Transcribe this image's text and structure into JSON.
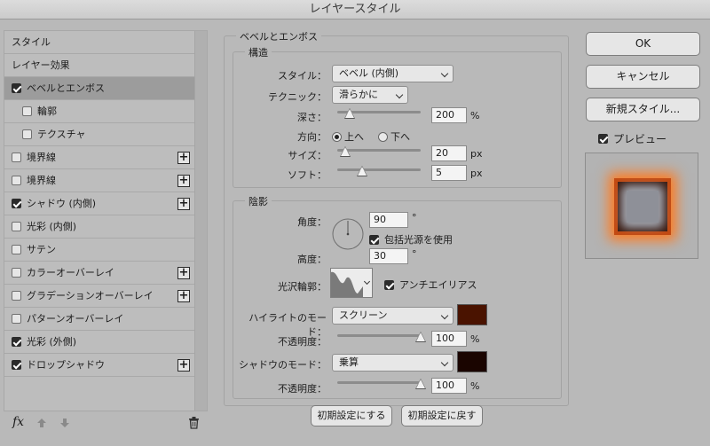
{
  "window": {
    "title": "レイヤースタイル"
  },
  "left_panel": {
    "items": [
      {
        "label": "スタイル",
        "checkbox": false,
        "checked": false,
        "plus": false,
        "selected": false,
        "sub": false
      },
      {
        "label": "レイヤー効果",
        "checkbox": false,
        "checked": false,
        "plus": false,
        "selected": false,
        "sub": false
      },
      {
        "label": "ベベルとエンボス",
        "checkbox": true,
        "checked": true,
        "plus": false,
        "selected": true,
        "sub": false
      },
      {
        "label": "輪郭",
        "checkbox": true,
        "checked": false,
        "plus": false,
        "selected": false,
        "sub": true
      },
      {
        "label": "テクスチャ",
        "checkbox": true,
        "checked": false,
        "plus": false,
        "selected": false,
        "sub": true
      },
      {
        "label": "境界線",
        "checkbox": true,
        "checked": false,
        "plus": true,
        "selected": false,
        "sub": false
      },
      {
        "label": "境界線",
        "checkbox": true,
        "checked": false,
        "plus": true,
        "selected": false,
        "sub": false
      },
      {
        "label": "シャドウ (内側)",
        "checkbox": true,
        "checked": true,
        "plus": true,
        "selected": false,
        "sub": false
      },
      {
        "label": "光彩 (内側)",
        "checkbox": true,
        "checked": false,
        "plus": false,
        "selected": false,
        "sub": false
      },
      {
        "label": "サテン",
        "checkbox": true,
        "checked": false,
        "plus": false,
        "selected": false,
        "sub": false
      },
      {
        "label": "カラーオーバーレイ",
        "checkbox": true,
        "checked": false,
        "plus": true,
        "selected": false,
        "sub": false
      },
      {
        "label": "グラデーションオーバーレイ",
        "checkbox": true,
        "checked": false,
        "plus": true,
        "selected": false,
        "sub": false
      },
      {
        "label": "パターンオーバーレイ",
        "checkbox": true,
        "checked": false,
        "plus": false,
        "selected": false,
        "sub": false
      },
      {
        "label": "光彩 (外側)",
        "checkbox": true,
        "checked": true,
        "plus": false,
        "selected": false,
        "sub": false
      },
      {
        "label": "ドロップシャドウ",
        "checkbox": true,
        "checked": true,
        "plus": true,
        "selected": false,
        "sub": false
      }
    ],
    "plus_symbol": "+",
    "bottom_icons": {
      "fx": "fx",
      "up": "arrow-up-icon",
      "down": "arrow-down-icon",
      "trash": "trash-icon"
    }
  },
  "bevel": {
    "group_title": "ベベルとエンボス",
    "structure": {
      "title": "構造",
      "style_label": "スタイル：",
      "style_value": "ベベル (内側)",
      "technique_label": "テクニック：",
      "technique_value": "滑らかに",
      "depth_label": "深さ：",
      "depth_value": "200",
      "depth_unit": "%",
      "depth_slider": 0.15,
      "direction_label": "方向：",
      "direction_up": "上へ",
      "direction_down": "下へ",
      "direction_selected": "up",
      "size_label": "サイズ：",
      "size_value": "20",
      "size_unit": "px",
      "size_slider": 0.1,
      "soften_label": "ソフト：",
      "soften_value": "5",
      "soften_unit": "px",
      "soften_slider": 0.3
    },
    "shading": {
      "title": "陰影",
      "angle_label": "角度：",
      "angle_value": "90",
      "angle_unit": "°",
      "global_light_label": "包括光源を使用",
      "global_light_checked": true,
      "altitude_label": "高度：",
      "altitude_value": "30",
      "altitude_unit": "°",
      "gloss_label": "光沢輪郭：",
      "antialias_label": "アンチエイリアス",
      "antialias_checked": true,
      "highlight_mode_label": "ハイライトのモード：",
      "highlight_mode_value": "スクリーン",
      "highlight_color": "#4a1300",
      "highlight_opacity_label": "不透明度：",
      "highlight_opacity_value": "100",
      "highlight_opacity_unit": "%",
      "highlight_opacity_slider": 1.0,
      "shadow_mode_label": "シャドウのモード：",
      "shadow_mode_value": "乗算",
      "shadow_color": "#1a0500",
      "shadow_opacity_label": "不透明度：",
      "shadow_opacity_value": "100",
      "shadow_opacity_unit": "%",
      "shadow_opacity_slider": 1.0
    },
    "reset_default": "初期設定にする",
    "restore_default": "初期設定に戻す"
  },
  "right_panel": {
    "ok": "OK",
    "cancel": "キャンセル",
    "new_style": "新規スタイル...",
    "preview_label": "プレビュー",
    "preview_checked": true
  }
}
